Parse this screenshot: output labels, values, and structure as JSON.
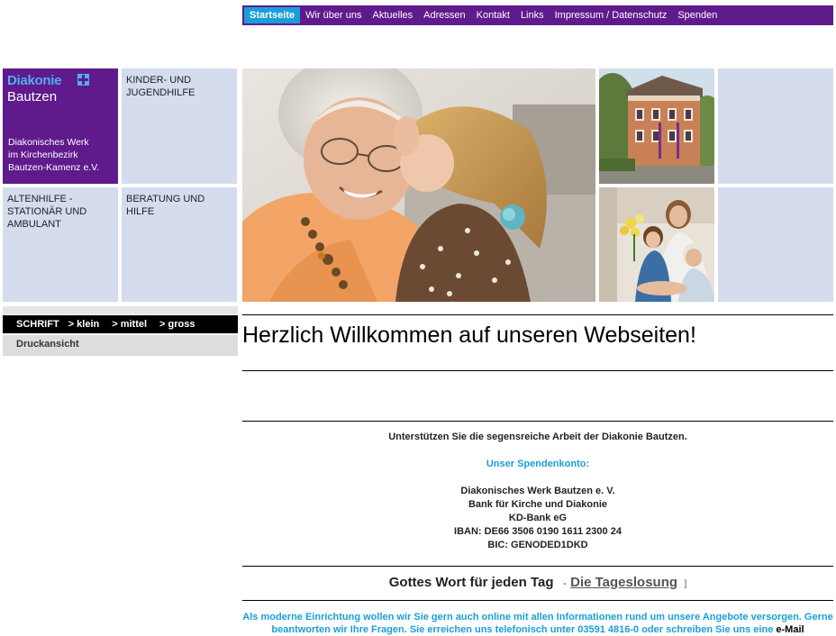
{
  "nav": {
    "items": [
      {
        "label": "Startseite",
        "active": true
      },
      {
        "label": "Wir über uns",
        "active": false
      },
      {
        "label": "Aktuelles",
        "active": false
      },
      {
        "label": "Adressen",
        "active": false
      },
      {
        "label": "Kontakt",
        "active": false
      },
      {
        "label": "Links",
        "active": false
      },
      {
        "label": "Impressum / Datenschutz",
        "active": false
      },
      {
        "label": "Spenden",
        "active": false
      }
    ]
  },
  "logo": {
    "brand": "Diakonie",
    "city": "Bautzen",
    "org": "Diakonisches Werk\nim Kirchenbezirk\nBautzen-Kamenz e.V."
  },
  "tiles": {
    "kinder": "Kinder- und\nJugendhilfe",
    "alten": "Altenhilfe -\nstationär und\nambulant",
    "beratung": "Beratung und\nHilfe"
  },
  "fontsize": {
    "label": "SCHRIFT",
    "small": "> klein",
    "medium": "> mittel",
    "large": "> gross"
  },
  "print_label": "Druckansicht",
  "welcome_heading": "Herzlich Willkommen auf unseren Webseiten!",
  "support": {
    "intro": "Unterstützen Sie die segensreiche Arbeit der Diakonie Bautzen.",
    "account_heading": "Unser Spendenkonto:",
    "account_name": "Diakonisches Werk Bautzen e. V.",
    "bank": "Bank für Kirche und Diakonie",
    "bank_short": "KD-Bank eG",
    "iban": "IBAN: DE66 3506 0190 1611 2300 24",
    "bic": "BIC: GENODED1DKD"
  },
  "daily": {
    "title": "Gottes Wort für jeden Tag",
    "sep": "-",
    "link": "Die Tageslosung",
    "ext": "]"
  },
  "modern": {
    "text": "Als moderne Einrichtung wollen wir Sie gern auch online mit allen Informationen rund um unsere Angebote versorgen. Gerne beantworten wir Ihre Fragen. Sie erreichen uns telefonisch unter 03591 4816-0 oder schreiben Sie uns eine",
    "mail": "e-Mail"
  },
  "colors": {
    "brand_purple": "#5f1a8c",
    "nav_active": "#1a9ed9",
    "tile_blue": "#d4dcee"
  }
}
